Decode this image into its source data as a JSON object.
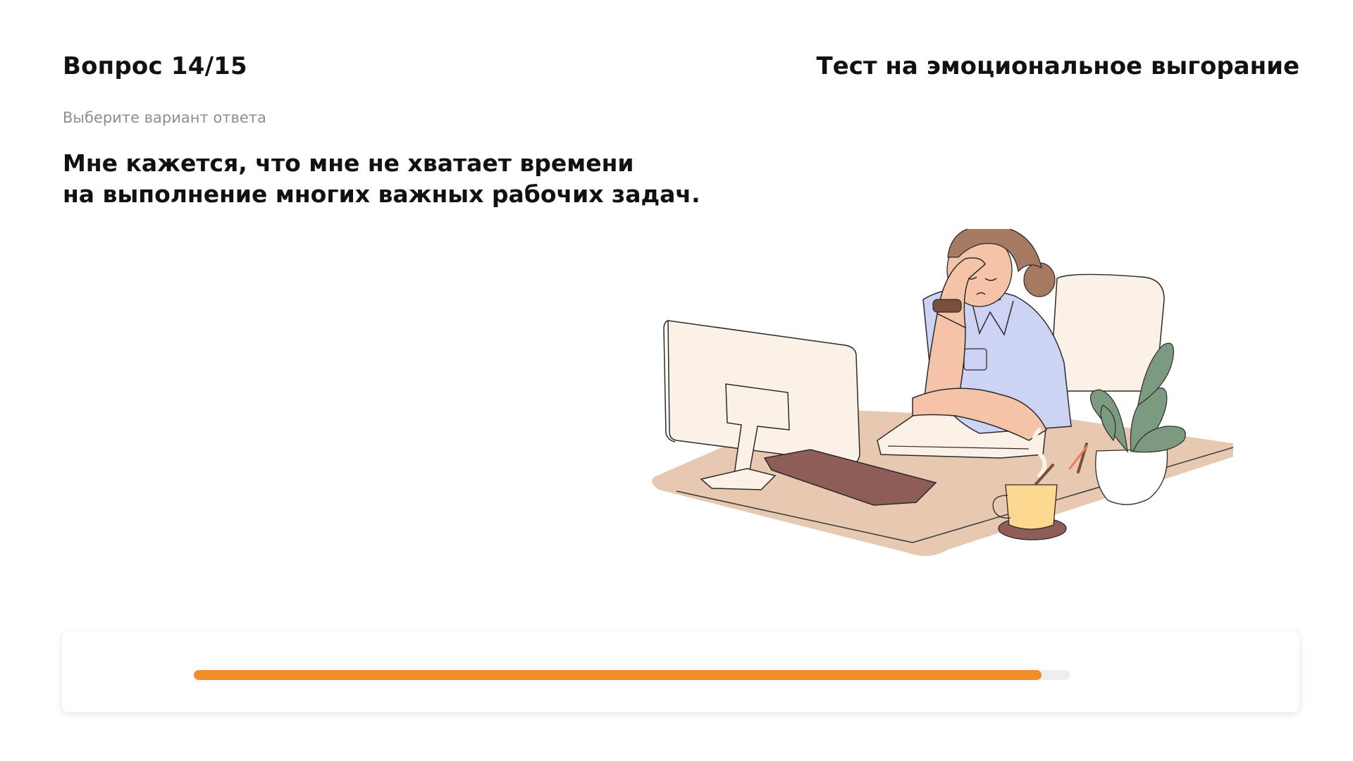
{
  "header": {
    "question_counter": "Вопрос 14/15",
    "test_title": "Тест на эмоциональное выгорание"
  },
  "main": {
    "instruction": "Выберите вариант ответа",
    "question_lines": [
      "Мне кажется, что мне не хватает времени",
      "на выполнение многих важных рабочих задач."
    ],
    "illustration_icon": "tired-woman-at-desk-illustration"
  },
  "progress": {
    "fraction": 0.967,
    "color": "#F28C28",
    "track_color": "#EEEEEE"
  }
}
